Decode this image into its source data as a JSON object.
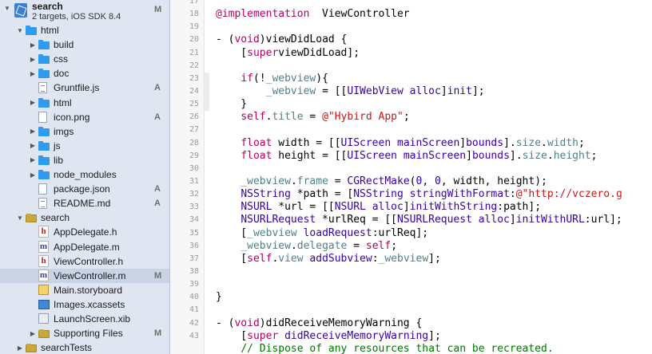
{
  "navigator": {
    "project": {
      "name": "search",
      "subtitle": "2 targets, iOS SDK 8.4",
      "status": "M"
    },
    "items": [
      {
        "label": "html",
        "kind": "folder-blue",
        "status": "",
        "disclosure": "open",
        "indent": 1,
        "icon_name": "folder-icon"
      },
      {
        "label": "build",
        "kind": "folder-blue",
        "status": "",
        "disclosure": "closed",
        "indent": 2,
        "icon_name": "folder-icon"
      },
      {
        "label": "css",
        "kind": "folder-blue",
        "status": "",
        "disclosure": "closed",
        "indent": 2,
        "icon_name": "folder-icon"
      },
      {
        "label": "doc",
        "kind": "folder-blue",
        "status": "",
        "disclosure": "closed",
        "indent": 2,
        "icon_name": "folder-icon"
      },
      {
        "label": "Gruntfile.js",
        "kind": "file-code",
        "status": "A",
        "disclosure": "",
        "indent": 2,
        "icon_name": "js-file-icon"
      },
      {
        "label": "html",
        "kind": "folder-blue",
        "status": "",
        "disclosure": "closed",
        "indent": 2,
        "icon_name": "folder-icon"
      },
      {
        "label": "icon.png",
        "kind": "file-plain",
        "status": "A",
        "disclosure": "",
        "indent": 2,
        "icon_name": "png-file-icon"
      },
      {
        "label": "imgs",
        "kind": "folder-blue",
        "status": "",
        "disclosure": "closed",
        "indent": 2,
        "icon_name": "folder-icon"
      },
      {
        "label": "js",
        "kind": "folder-blue",
        "status": "",
        "disclosure": "closed",
        "indent": 2,
        "icon_name": "folder-icon"
      },
      {
        "label": "lib",
        "kind": "folder-blue",
        "status": "",
        "disclosure": "closed",
        "indent": 2,
        "icon_name": "folder-icon"
      },
      {
        "label": "node_modules",
        "kind": "folder-blue",
        "status": "",
        "disclosure": "closed",
        "indent": 2,
        "icon_name": "folder-icon"
      },
      {
        "label": "package.json",
        "kind": "file-plain",
        "status": "A",
        "disclosure": "",
        "indent": 2,
        "icon_name": "json-file-icon"
      },
      {
        "label": "README.md",
        "kind": "file-code",
        "status": "A",
        "disclosure": "",
        "indent": 2,
        "icon_name": "md-file-icon"
      },
      {
        "label": "search",
        "kind": "folder-yellow",
        "status": "",
        "disclosure": "open",
        "indent": 1,
        "icon_name": "group-folder-icon"
      },
      {
        "label": "AppDelegate.h",
        "kind": "h",
        "status": "",
        "disclosure": "",
        "indent": 2,
        "icon_name": "header-file-icon"
      },
      {
        "label": "AppDelegate.m",
        "kind": "m",
        "status": "",
        "disclosure": "",
        "indent": 2,
        "icon_name": "implementation-file-icon"
      },
      {
        "label": "ViewController.h",
        "kind": "h",
        "status": "",
        "disclosure": "",
        "indent": 2,
        "icon_name": "header-file-icon"
      },
      {
        "label": "ViewController.m",
        "kind": "m",
        "status": "M",
        "disclosure": "",
        "indent": 2,
        "icon_name": "implementation-file-icon"
      },
      {
        "label": "Main.storyboard",
        "kind": "storyboard",
        "status": "",
        "disclosure": "",
        "indent": 2,
        "icon_name": "storyboard-icon"
      },
      {
        "label": "Images.xcassets",
        "kind": "xcassets",
        "status": "",
        "disclosure": "",
        "indent": 2,
        "icon_name": "asset-catalog-icon"
      },
      {
        "label": "LaunchScreen.xib",
        "kind": "xib",
        "status": "",
        "disclosure": "",
        "indent": 2,
        "icon_name": "xib-file-icon"
      },
      {
        "label": "Supporting Files",
        "kind": "folder-yellow",
        "status": "M",
        "disclosure": "closed",
        "indent": 2,
        "icon_name": "group-folder-icon"
      },
      {
        "label": "searchTests",
        "kind": "folder-yellow",
        "status": "",
        "disclosure": "closed",
        "indent": 1,
        "icon_name": "group-folder-icon"
      }
    ]
  },
  "editor": {
    "first_line": 17,
    "line_count": 43,
    "lines": [
      [],
      [
        [
          "kw",
          "@implementation"
        ],
        [
          "",
          "  ViewController"
        ]
      ],
      [],
      [
        [
          "",
          "- ("
        ],
        [
          "kw",
          "void"
        ],
        [
          "",
          ")viewDidLoad {"
        ]
      ],
      [
        [
          "",
          "    ["
        ],
        [
          "kw",
          "super"
        ],
        [
          "",
          ""
        ],
        [
          "",
          "viewDidLoad"
        ],
        [
          "",
          "];"
        ]
      ],
      [],
      [
        [
          "",
          "    "
        ],
        [
          "kw",
          "if"
        ],
        [
          "",
          "(!"
        ],
        [
          "prop",
          "_webview"
        ],
        [
          "",
          "){"
        ]
      ],
      [
        [
          "",
          "        "
        ],
        [
          "prop",
          "_webview"
        ],
        [
          "",
          " = [["
        ],
        [
          "cls",
          "UIWebView"
        ],
        [
          "",
          " "
        ],
        [
          "cls",
          "alloc"
        ],
        [
          "",
          "]"
        ],
        [
          "cls",
          "init"
        ],
        [
          "",
          "];"
        ]
      ],
      [
        [
          "",
          "    }"
        ]
      ],
      [
        [
          "",
          "    "
        ],
        [
          "kw",
          "self"
        ],
        [
          "",
          "."
        ],
        [
          "prop",
          "title"
        ],
        [
          "",
          " = "
        ],
        [
          "str",
          "@\"Hybird App\""
        ],
        [
          "",
          ";"
        ]
      ],
      [],
      [
        [
          "",
          "    "
        ],
        [
          "kw",
          "float"
        ],
        [
          "",
          " width = [["
        ],
        [
          "cls",
          "UIScreen"
        ],
        [
          "",
          " "
        ],
        [
          "cls",
          "mainScreen"
        ],
        [
          "",
          "]"
        ],
        [
          "cls",
          "bounds"
        ],
        [
          "",
          "]."
        ],
        [
          "prop",
          "size"
        ],
        [
          "",
          "."
        ],
        [
          "prop",
          "width"
        ],
        [
          "",
          ";"
        ]
      ],
      [
        [
          "",
          "    "
        ],
        [
          "kw",
          "float"
        ],
        [
          "",
          " height = [["
        ],
        [
          "cls",
          "UIScreen"
        ],
        [
          "",
          " "
        ],
        [
          "cls",
          "mainScreen"
        ],
        [
          "",
          "]"
        ],
        [
          "cls",
          "bounds"
        ],
        [
          "",
          "]."
        ],
        [
          "prop",
          "size"
        ],
        [
          "",
          "."
        ],
        [
          "prop",
          "height"
        ],
        [
          "",
          ";"
        ]
      ],
      [],
      [
        [
          "",
          "    "
        ],
        [
          "prop",
          "_webview"
        ],
        [
          "",
          "."
        ],
        [
          "prop",
          "frame"
        ],
        [
          "",
          " = "
        ],
        [
          "cls",
          "CGRectMake"
        ],
        [
          "",
          "("
        ],
        [
          "num",
          "0"
        ],
        [
          "",
          ", "
        ],
        [
          "num",
          "0"
        ],
        [
          "",
          ", width, height);"
        ]
      ],
      [
        [
          "",
          "    "
        ],
        [
          "cls",
          "NSString"
        ],
        [
          "",
          " *path = ["
        ],
        [
          "cls",
          "NSString"
        ],
        [
          "",
          " "
        ],
        [
          "cls",
          "stringWithFormat"
        ],
        [
          "",
          ":"
        ],
        [
          "str",
          "@\"http://vczero.g"
        ]
      ],
      [
        [
          "",
          "    "
        ],
        [
          "cls",
          "NSURL"
        ],
        [
          "",
          " *url = [["
        ],
        [
          "cls",
          "NSURL"
        ],
        [
          "",
          " "
        ],
        [
          "cls",
          "alloc"
        ],
        [
          "",
          "]"
        ],
        [
          "cls",
          "initWithString"
        ],
        [
          "",
          ":path];"
        ]
      ],
      [
        [
          "",
          "    "
        ],
        [
          "cls",
          "NSURLRequest"
        ],
        [
          "",
          " *urlReq = [["
        ],
        [
          "cls",
          "NSURLRequest"
        ],
        [
          "",
          " "
        ],
        [
          "cls",
          "alloc"
        ],
        [
          "",
          "]"
        ],
        [
          "cls",
          "initWithURL"
        ],
        [
          "",
          ":url];"
        ]
      ],
      [
        [
          "",
          "    ["
        ],
        [
          "prop",
          "_webview"
        ],
        [
          "",
          " "
        ],
        [
          "cls",
          "loadRequest"
        ],
        [
          "",
          ":urlReq];"
        ]
      ],
      [
        [
          "",
          "    "
        ],
        [
          "prop",
          "_webview"
        ],
        [
          "",
          "."
        ],
        [
          "prop",
          "delegate"
        ],
        [
          "",
          " = "
        ],
        [
          "kw",
          "self"
        ],
        [
          "",
          ";"
        ]
      ],
      [
        [
          "",
          "    ["
        ],
        [
          "kw",
          "self"
        ],
        [
          "",
          "."
        ],
        [
          "prop",
          "view"
        ],
        [
          "",
          " "
        ],
        [
          "cls",
          "addSubview"
        ],
        [
          "",
          ":"
        ],
        [
          "prop",
          "_webview"
        ],
        [
          "",
          "];"
        ]
      ],
      [],
      [],
      [
        [
          "",
          "}"
        ]
      ],
      [],
      [
        [
          "",
          "- ("
        ],
        [
          "kw",
          "void"
        ],
        [
          "",
          ")didReceiveMemoryWarning {"
        ]
      ],
      [
        [
          "",
          "    ["
        ],
        [
          "kw",
          "super"
        ],
        [
          "",
          " "
        ],
        [
          "cls",
          "didReceiveMemoryWarning"
        ],
        [
          "",
          "];"
        ]
      ],
      [
        [
          "",
          "    "
        ],
        [
          "cm",
          "// Dispose of any resources that can be recreated."
        ]
      ],
      [
        [
          "",
          "}"
        ]
      ]
    ]
  },
  "colors": {
    "sidebar_bg": "#dfe6f2",
    "folder_blue": "#2f9bf0",
    "folder_yellow": "#c9a83a",
    "keyword": "#b40062",
    "class": "#3900a0",
    "property": "#4f8187",
    "string": "#c41a16",
    "comment": "#007400",
    "number": "#1c00cf"
  }
}
